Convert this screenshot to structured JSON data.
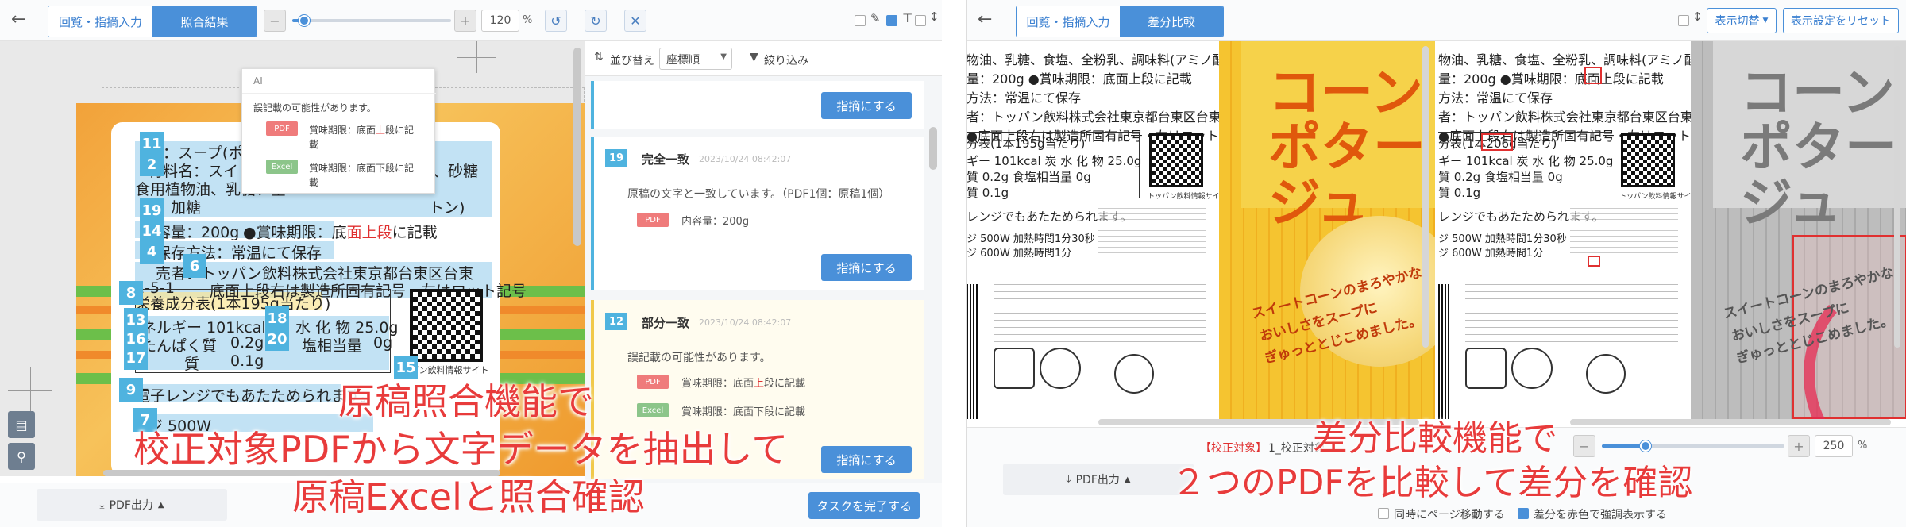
{
  "left": {
    "toolbar": {
      "back_icon": "arrow-left-icon",
      "tab_input": "回覧・指摘入力",
      "tab_result": "照合結果",
      "zoom_minus": "−",
      "zoom_plus": "+",
      "zoom_value": "120",
      "zoom_unit": "%",
      "zoom_fraction": 0.12
    },
    "popup": {
      "header": "AI",
      "message": "誤記載の可能性があります。",
      "pdf_tag": "PDF",
      "pdf_text_a": "賞味期限：底面",
      "pdf_text_hl": "上",
      "pdf_text_b": "段に記",
      "pdf_text_c": "載",
      "excel_tag": "Excel",
      "excel_text_a": "賞味期限：底面下段に記",
      "excel_text_b": "載"
    },
    "doc": {
      "badges": [
        "11",
        "2",
        "19",
        "14",
        "4",
        "6",
        "8",
        "13",
        "16",
        "17",
        "18",
        "20",
        "15",
        "9",
        "7"
      ],
      "line1": "名：スープ(ポ",
      "line2": "材料名：スイ",
      "line2b": "、砂糖",
      "line3": "食用植物油、乳糖、全",
      "line4": "、加糖",
      "line5": "トン)",
      "line6a": "容量：200g",
      "line6b": "●賞味期限：底",
      "line6c": "面上段",
      "line6d": "に記載",
      "line7": "保存方法：常温にて保存",
      "line8": "売者：トッパン飲料株式会社東京都台東区台東",
      "line9": "1-5-1",
      "line9b": "底面上段右は製造所固有記号・左はロット記号",
      "line10": "栄養成分表(1本195g当たり)",
      "line11a": "ネルギー 101kcal",
      "line11b": "水 化 物 25.0g",
      "line12a": "たんぱく質",
      "line12b": "0.2g",
      "line12c": "塩相当量",
      "line12d": "0g",
      "line13a": "質",
      "line13b": "0.1g",
      "line14": "電子レンジでもあたためられます。",
      "line15": "ジ 500W",
      "qr_caption": "パン飲料情報サイト"
    },
    "list": {
      "sort_label": "並び替え",
      "sort_value": "座標順",
      "filter_label": "絞り込み",
      "btn_point": "指摘にする",
      "cards": [
        {
          "num": "19",
          "title": "完全一致",
          "time": "2023/10/24 08:42:07",
          "text": "原稿の文字と一致しています。（PDF1個：原稿1個）",
          "pdf": "PDF",
          "pdf_text": "内容量：200g"
        },
        {
          "num": "12",
          "title": "部分一致",
          "time": "2023/10/24 08:42:07",
          "text": "誤記載の可能性があります。",
          "pdf": "PDF",
          "pdf_text_a": "賞味期限：底面",
          "pdf_text_hl": "上",
          "pdf_text_b": "段に記載",
          "excel": "Excel",
          "excel_text": "賞味期限：底面下段に記載"
        }
      ],
      "complete_button": "タスクを完了する"
    },
    "footer": {
      "pdf_out": "PDF出力",
      "pdf_out_icon": "download-icon"
    },
    "caption": {
      "l1": "原稿照合機能で",
      "l2": "校正対象PDFから文字データを抽出して",
      "l3": "原稿Excelと照合確認"
    }
  },
  "right": {
    "toolbar": {
      "back_icon": "arrow-left-icon",
      "tab_input": "回覧・指摘入力",
      "tab_diff": "差分比較",
      "display_switch": "表示切替",
      "reset_display": "表示設定をリセット"
    },
    "doc": {
      "t1": "物油、乳糖、食塩、全粉乳、調味料(アミノ酸等)、",
      "t2": "量：200g ●賞味期限：底面上段に記載",
      "t3": "方法：常温にて保存",
      "t4": "者：トッパン飲料株式会社東京都台東区台東",
      "t5": "●底面上段右は製造所固有記号・左はロット記号",
      "t6": "分表(1本195g当たり)",
      "t6_diff": "分表(1本206g当たり)",
      "t7": "ギー 101kcal 炭 水 化 物 25.0g",
      "t8": "質    0.2g  食塩相当量    0g",
      "t9": "質    0.1g",
      "t10": "レンジでもあたためられます。",
      "t11": "ジ 500W 加熱時間1分30秒",
      "t12": "ジ 600W 加熱時間1分",
      "qr_caption": "トッパン飲料情報サイト",
      "product_title": "コーンポタージュ",
      "product_copy1": "スイートコーンのまろやかな",
      "product_copy2": "おいしさをスープに",
      "product_copy3": "ぎゅっととじこめました。"
    },
    "footer": {
      "target_label": "【校正対象】",
      "target_file": "1_校正対象",
      "pdf_out": "PDF出力",
      "zoom_value": "250",
      "zoom_unit": "%",
      "sync_label": "同時にページ移動する",
      "highlight_label": "差分を赤色で強調表示する"
    },
    "caption": {
      "l1": "差分比較機能で",
      "l2": "２つのPDFを比較して差分を確認"
    }
  }
}
